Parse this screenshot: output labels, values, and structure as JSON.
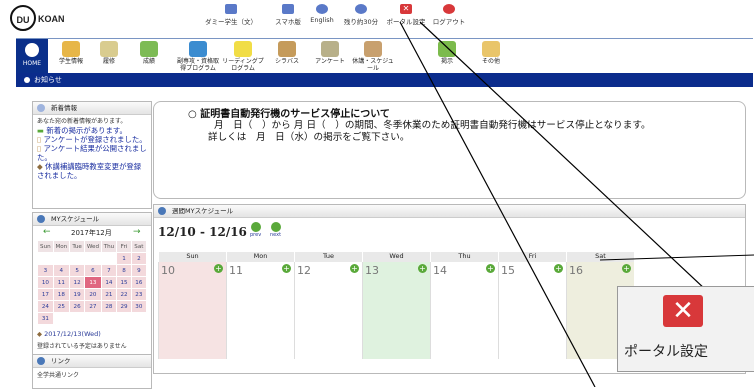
{
  "header": {
    "logo_mark": "DU",
    "logo_text": "KOAN",
    "links": [
      {
        "label": "ダミー学生（文）",
        "icon": "person-icon",
        "color": "#5a79c8"
      },
      {
        "label": "スマホ版",
        "icon": "smartphone-icon",
        "color": "#5a79c8"
      },
      {
        "label": "English",
        "icon": "globe-icon",
        "color": "#5a79c8"
      },
      {
        "label": "残り約30分",
        "icon": "clock-icon",
        "color": "#5a79c8"
      },
      {
        "label": "ポータル設定",
        "icon": "tools-icon",
        "color": "#d8383a"
      },
      {
        "label": "ログアウト",
        "icon": "power-icon",
        "color": "#d8383a"
      }
    ]
  },
  "nav": {
    "home": "HOME",
    "items": [
      "学生情報",
      "履修",
      "成績",
      "副専攻・資格取得プログラム",
      "リーディングプログラム",
      "シラバス",
      "アンケート",
      "休講・スケジュール",
      "掲示",
      "その他"
    ]
  },
  "notice_bar": "お知らせ",
  "news": {
    "title": "新着情報",
    "intro": "あなた宛の新着情報があります。",
    "items": [
      "新着の掲示があります。",
      "アンケートが登録されました。",
      "アンケート結果が公開されました。",
      "休講補講臨時教室変更が登録されました。"
    ]
  },
  "notice": {
    "title": "○ 証明書自動発行機のサービス停止について",
    "line1": "月　日（　）から 月 日（　）の期間、冬季休業のため証明書自動発行機はサービス停止となります。",
    "line2": "詳しくは　月　日（水）の掲示をご覧下さい。"
  },
  "my_schedule": {
    "title": "MYスケジュール",
    "month": "2017年12月",
    "weekdays": [
      "Sun",
      "Mon",
      "Tue",
      "Wed",
      "Thu",
      "Fri",
      "Sat"
    ],
    "weeks": [
      [
        "",
        "",
        "",
        "",
        "",
        "1",
        "2"
      ],
      [
        "3",
        "4",
        "5",
        "6",
        "7",
        "8",
        "9"
      ],
      [
        "10",
        "11",
        "12",
        "13",
        "14",
        "15",
        "16"
      ],
      [
        "17",
        "18",
        "19",
        "20",
        "21",
        "22",
        "23"
      ],
      [
        "24",
        "25",
        "26",
        "27",
        "28",
        "29",
        "30"
      ],
      [
        "31",
        "",
        "",
        "",
        "",
        "",
        ""
      ]
    ],
    "today": "13",
    "selected_date": "2017/12/13(Wed)",
    "empty_msg": "登録されている予定はありません"
  },
  "links_panel": {
    "title": "リンク",
    "item": "全学共通リンク"
  },
  "weekly": {
    "title": "週間MYスケジュール",
    "range": "12/10 - 12/16",
    "prev": "prev",
    "next": "next",
    "days": [
      {
        "name": "Sun",
        "num": "10",
        "color": "#f6e3e3"
      },
      {
        "name": "Mon",
        "num": "11",
        "color": "#ffffff"
      },
      {
        "name": "Tue",
        "num": "12",
        "color": "#ffffff"
      },
      {
        "name": "Wed",
        "num": "13",
        "color": "#dff2df"
      },
      {
        "name": "Thu",
        "num": "14",
        "color": "#ffffff"
      },
      {
        "name": "Fri",
        "num": "15",
        "color": "#ffffff"
      },
      {
        "name": "Sat",
        "num": "16",
        "color": "#eeeede"
      }
    ]
  },
  "zoom_callout": {
    "label": "ポータル設定",
    "icon": "tools-icon"
  }
}
